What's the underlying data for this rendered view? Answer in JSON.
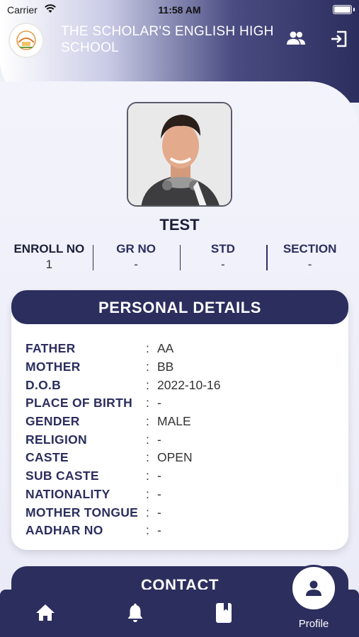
{
  "status_bar": {
    "carrier": "Carrier",
    "time": "11:58 AM"
  },
  "header": {
    "school_name": "THE SCHOLAR'S ENGLISH HIGH SCHOOL",
    "icons": [
      "students-icon",
      "logout-icon"
    ]
  },
  "student": {
    "name": "TEST",
    "info": [
      {
        "label": "ENROLL NO",
        "value": "1"
      },
      {
        "label": "GR NO",
        "value": "-"
      },
      {
        "label": "STD",
        "value": "-"
      },
      {
        "label": "SECTION",
        "value": "-"
      }
    ]
  },
  "personal_details": {
    "title": "PERSONAL DETAILS",
    "rows": [
      {
        "label": "FATHER",
        "value": "AA"
      },
      {
        "label": "MOTHER",
        "value": "BB"
      },
      {
        "label": "D.O.B",
        "value": "2022-10-16"
      },
      {
        "label": "PLACE OF BIRTH",
        "value": "-"
      },
      {
        "label": "GENDER",
        "value": "MALE"
      },
      {
        "label": "RELIGION",
        "value": "-"
      },
      {
        "label": "CASTE",
        "value": "OPEN"
      },
      {
        "label": "SUB CASTE",
        "value": "-"
      },
      {
        "label": "NATIONALITY",
        "value": "-"
      },
      {
        "label": "MOTHER TONGUE",
        "value": "-"
      },
      {
        "label": "AADHAR NO",
        "value": "-"
      }
    ]
  },
  "contact": {
    "title": "CONTACT"
  },
  "bottom_nav": {
    "items": [
      "home-icon",
      "bell-icon",
      "book-icon",
      "profile-icon"
    ],
    "profile_label": "Profile"
  },
  "colors": {
    "primary": "#2c2e5e",
    "background": "#eef0f8",
    "card": "#ffffff"
  }
}
